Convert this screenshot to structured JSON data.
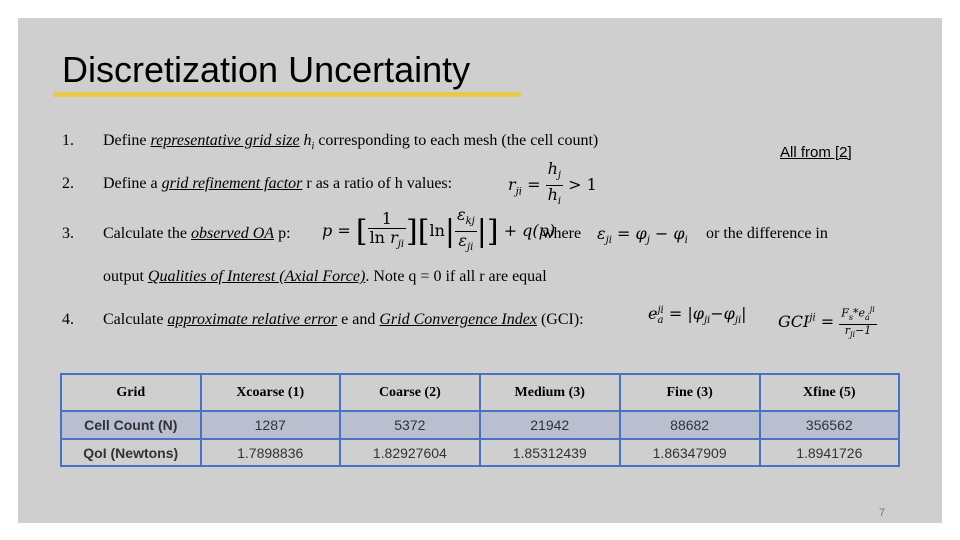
{
  "slide": {
    "title": "Discretization Uncertainty",
    "reference": "All from [2]",
    "page_number": "7",
    "accent_color": "#e8c94a",
    "table_border_color": "#4a72c4"
  },
  "steps": [
    {
      "number": "1.",
      "prefix": "Define ",
      "term": "representative grid size",
      "mid": " h",
      "sub": "i",
      "suffix": " corresponding to each mesh (the cell count)"
    },
    {
      "number": "2.",
      "prefix": "Define a ",
      "term": "grid refinement factor",
      "suffix": " r as a ratio of h values:",
      "formula_lhs": "r",
      "formula_lhs_sub": "ji",
      "formula_num": "h",
      "formula_num_sub": "j",
      "formula_den": "h",
      "formula_den_sub": "i",
      "formula_tail": "> 1"
    },
    {
      "number": "3.",
      "prefix": "Calculate the ",
      "term": "observed OA",
      "suffix": " p:",
      "formula": "p = [1 / ln r_ji] [ln |ε_kj / ε_ji|] + q(p)",
      "where_label": "where",
      "where_formula": "ε_ji = φ_j − φ_i",
      "tail": "or the difference in",
      "line2_prefix": "output ",
      "line2_term": "Qualities of Interest (Axial Force)",
      "line2_suffix": ". Note q = 0 if all r are equal"
    },
    {
      "number": "4.",
      "prefix": "Calculate ",
      "term": "approximate relative error",
      "mid": " e and ",
      "term2": "Grid Convergence Index",
      "suffix": " (GCI):",
      "formula_e": "e_a^ji = |φ_ji − φ_ji|",
      "formula_gci": "GCI^ji = F_s*e_a^ji / (r_ji − 1)"
    }
  ],
  "table": {
    "headers": [
      "Grid",
      "Xcoarse (1)",
      "Coarse (2)",
      "Medium (3)",
      "Fine (3)",
      "Xfine (5)"
    ],
    "rows": [
      {
        "label": "Cell Count (N)",
        "values": [
          "1287",
          "5372",
          "21942",
          "88682",
          "356562"
        ]
      },
      {
        "label": "QoI (Newtons)",
        "values": [
          "1.7898836",
          "1.82927604",
          "1.85312439",
          "1.86347909",
          "1.8941726"
        ]
      }
    ]
  }
}
